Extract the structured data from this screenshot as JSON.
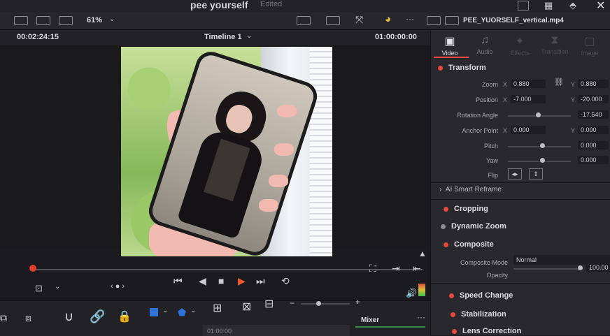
{
  "app": {
    "project_title": "pee yourself",
    "edited_status": "Edited"
  },
  "toolbar": {
    "zoom": "61%",
    "clip_name": "PEE_YUORSELF_vertical.mp4"
  },
  "viewer": {
    "source_timecode": "00:02:24:15",
    "timeline_name": "Timeline 1",
    "record_timecode": "01:00:00:00"
  },
  "inspector": {
    "tabs": [
      {
        "label": "Video",
        "icon": "film-icon"
      },
      {
        "label": "Audio",
        "icon": "music-note-icon"
      },
      {
        "label": "Effects",
        "icon": "effects-icon"
      },
      {
        "label": "Transition",
        "icon": "transition-icon"
      },
      {
        "label": "Image",
        "icon": "image-icon"
      }
    ],
    "transform": {
      "title": "Transform",
      "zoom_label": "Zoom",
      "zoom_x": "0.880",
      "zoom_y": "0.880",
      "position_label": "Position",
      "position_x": "-7.000",
      "position_y": "-20.000",
      "rotation_label": "Rotation Angle",
      "rotation_value": "-17.540",
      "anchor_label": "Anchor Point",
      "anchor_x": "0.000",
      "anchor_y": "0.000",
      "pitch_label": "Pitch",
      "pitch_value": "0.000",
      "yaw_label": "Yaw",
      "yaw_value": "0.000",
      "flip_label": "Flip",
      "x_axis": "X",
      "y_axis": "Y"
    },
    "smart_reframe": "AI Smart Reframe",
    "cropping": "Cropping",
    "dynamic_zoom": "Dynamic Zoom",
    "composite": {
      "title": "Composite",
      "mode_label": "Composite Mode",
      "mode_value": "Normal",
      "opacity_label": "Opacity",
      "opacity_value": "100.00"
    },
    "speed_change": "Speed Change",
    "stabilization": "Stabilization",
    "lens_correction": "Lens Correction"
  },
  "mixer": {
    "label": "Mixer"
  },
  "timeline_ruler": {
    "timecode": "01:00:00"
  }
}
